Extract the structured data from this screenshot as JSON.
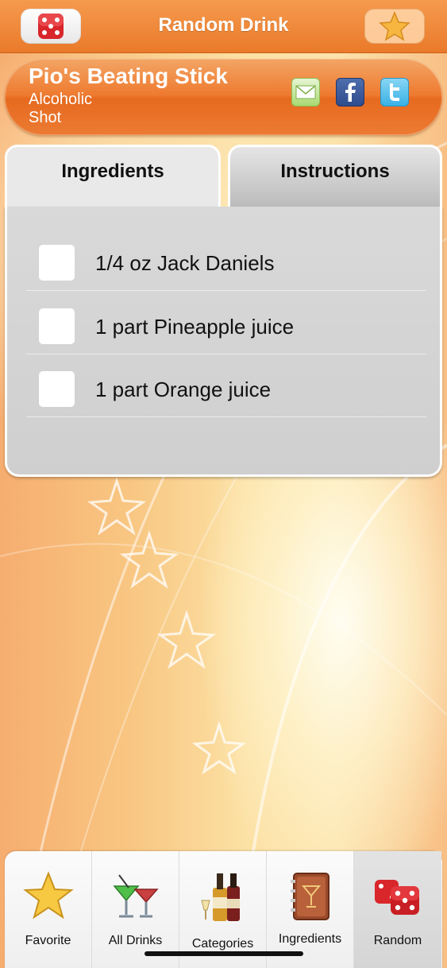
{
  "nav": {
    "title": "Random Drink",
    "left_icon": "dice-icon",
    "right_icon": "star-icon"
  },
  "drink": {
    "name": "Pio's Beating Stick",
    "type": "Alcoholic",
    "category": "Shot",
    "share_icons": [
      "mail-icon",
      "facebook-icon",
      "twitter-icon"
    ]
  },
  "tabs": {
    "ingredients": "Ingredients",
    "instructions": "Instructions"
  },
  "ingredients": [
    {
      "text": "1/4 oz Jack Daniels",
      "checked": false
    },
    {
      "text": "1 part Pineapple juice",
      "checked": false
    },
    {
      "text": "1 part Orange juice",
      "checked": false
    }
  ],
  "tabbar": {
    "items": [
      {
        "label": "Favorite",
        "icon": "star-icon"
      },
      {
        "label": "All Drinks",
        "icon": "cocktail-glasses-icon"
      },
      {
        "label": "Categories",
        "icon": "bottles-icon"
      },
      {
        "label": "Ingredients",
        "icon": "recipe-book-icon"
      },
      {
        "label": "Random",
        "icon": "dice-icon"
      }
    ],
    "selected": "Random"
  },
  "colors": {
    "accent": "#ee7a2f",
    "panel": "#d9d9d9"
  }
}
